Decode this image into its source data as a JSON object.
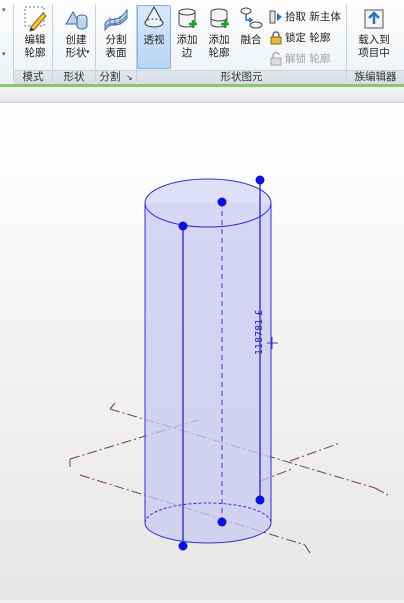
{
  "ribbon": {
    "mode": {
      "edit_profile_line1": "编辑",
      "edit_profile_line2": "轮廓",
      "group": "模式"
    },
    "form": {
      "create_line1": "创建",
      "create_line2": "形状",
      "group": "形状"
    },
    "divide": {
      "divide_line1": "分割",
      "divide_line2": "表面",
      "group": "分割"
    },
    "form_element": {
      "xray": "透视",
      "add_edge_line1": "添加",
      "add_edge_line2": "边",
      "add_profile_line1": "添加",
      "add_profile_line2": "轮廓",
      "blend": "融合",
      "pick_host": "拾取 新主体",
      "lock_profile": "锁定 轮廓",
      "unlock_profile": "解锁 轮廓",
      "group": "形状图元"
    },
    "family_editor": {
      "load_line1": "载入到",
      "load_line2": "项目中",
      "group": "族编辑器"
    }
  },
  "viewport": {
    "dimension_label": "118781 £"
  },
  "colors": {
    "accent": "#1a1aff",
    "shape_fill": "#c9c9f2",
    "edge": "#3333cc",
    "ground": "#7a3a52"
  }
}
